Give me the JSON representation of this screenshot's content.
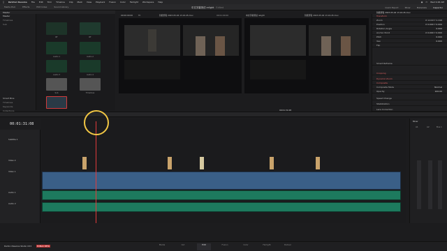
{
  "menubar": {
    "app": "DaVinci Resolve",
    "items": [
      "File",
      "Edit",
      "Trim",
      "Timeline",
      "Clip",
      "Mark",
      "View",
      "Playback",
      "Fusion",
      "Color",
      "Fairlight",
      "Workspace",
      "Help"
    ],
    "status": "Wed 9:46 AM"
  },
  "toolbar": {
    "media_pool": "Media Pool",
    "effects": "Effects",
    "edit_index": "Edit Index",
    "sound_library": "Sound Library",
    "project_title": "中文字幕测试 relight",
    "project_status": "Edited",
    "quick_export": "Quick Export",
    "mixer": "Mixer",
    "metadata": "Metadata",
    "inspector": "Inspector"
  },
  "mediapool": {
    "master_label": "Master",
    "bins": [
      "Master",
      "Timelines",
      "Sub"
    ],
    "smart_bins": "Smart Bins",
    "smart_items": [
      "Timelines",
      "Keywords",
      "Collections"
    ],
    "clips": [
      {
        "name": "RT",
        "color": "#1b3a2e"
      },
      {
        "name": "RT",
        "color": "#20402f"
      },
      {
        "name": "Audio 1",
        "color": "#19402c"
      },
      {
        "name": "Audio 2",
        "color": "#19402c"
      },
      {
        "name": "Audio 3",
        "color": "#19402c"
      },
      {
        "name": "Audio 4",
        "color": "#19402c"
      },
      {
        "name": "Sub",
        "color": "#444"
      },
      {
        "name": "Timelines",
        "color": "#444"
      },
      {
        "name": "Timeline 1",
        "color": "#2a3a46"
      }
    ]
  },
  "viewer": {
    "left_timecode": "00:00:00:00",
    "left_zoom": "Fit",
    "left_label": "智能剪辑 2023-05-04 13.16.45.mov",
    "left_tc_right": "00:01:00:00",
    "right_label": "中文字幕测试 relight",
    "right_tc": "00:01:31:08",
    "right_tc_label": "智能剪辑 2023-05-04 13.16.45.mov"
  },
  "inspector": {
    "title": "智能剪辑 2023-05-04 13.16.45.mov",
    "tabs": [
      "Video",
      "Audio",
      "Effects",
      "Transition",
      "Image",
      "File"
    ],
    "sections": [
      {
        "label": "Transform",
        "value": ""
      },
      {
        "label": "Zoom",
        "value": "X 1.110   Y 1.110"
      },
      {
        "label": "Position",
        "value": "X 0.000   Y 0.000"
      },
      {
        "label": "Rotation Angle",
        "value": "0.000"
      },
      {
        "label": "Anchor Point",
        "value": "X 0.000   Y 0.000"
      },
      {
        "label": "Pitch",
        "value": "0.000"
      },
      {
        "label": "Yaw",
        "value": "0.000"
      },
      {
        "label": "Flip",
        "value": ""
      },
      {
        "label": "Smart Reframe",
        "value": ""
      },
      {
        "label": "Cropping",
        "value": ""
      },
      {
        "label": "Dynamic Zoom",
        "value": ""
      },
      {
        "label": "Composite",
        "value": ""
      },
      {
        "label": "Composite Mode",
        "value": "Normal"
      },
      {
        "label": "Opacity",
        "value": "100.00"
      },
      {
        "label": "Speed Change",
        "value": ""
      },
      {
        "label": "Stabilization",
        "value": ""
      },
      {
        "label": "Lens Correction",
        "value": ""
      }
    ]
  },
  "timeline": {
    "timecode": "00:01:31:08",
    "tracks": [
      {
        "id": "ST1",
        "name": "Subtitle 1",
        "detail": "1 Clip"
      },
      {
        "id": "V2",
        "name": "Video 2",
        "detail": "4 Clips"
      },
      {
        "id": "V1",
        "name": "Video 1",
        "detail": "71 Clips"
      },
      {
        "id": "A1",
        "name": "Audio 1",
        "detail": "2.0"
      },
      {
        "id": "A2",
        "name": "Audio 2",
        "detail": "2.0"
      }
    ],
    "ruler_marks": [
      "01:00:00:00",
      "01:00:40:00",
      "01:01:20:00",
      "01:02:00:00",
      "01:02:40:00",
      "01:03:20:00",
      "01:04:00:00",
      "01:04:40:00",
      "01:05:20:00",
      "01:06:00:00",
      "01:06:40:00"
    ]
  },
  "mixer": {
    "title": "Mixer",
    "channels": [
      "A1",
      "A2",
      "Bus 1"
    ],
    "labels": [
      "Audio 1",
      "Audio 2",
      "Main 1"
    ]
  },
  "bottom": {
    "app_version": "DaVinci Resolve Studio 18.5",
    "badge": "PUBLIC BETA",
    "pages": [
      "Media",
      "Cut",
      "Edit",
      "Fusion",
      "Color",
      "Fairlight",
      "Deliver"
    ]
  }
}
